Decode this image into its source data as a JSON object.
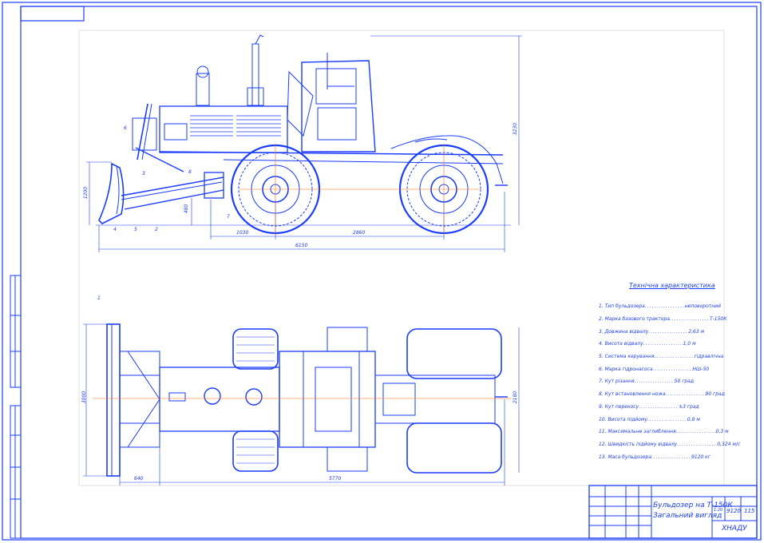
{
  "drawing": {
    "title_line1": "Бульдозер на Т-150К",
    "title_line2": "Загальний вигляд",
    "sheet_code": "ХНАДУ",
    "scale": "1:20",
    "mass": "9120",
    "sheet_no": "115"
  },
  "specs": {
    "heading": "Технічна характеристика",
    "items": [
      {
        "label": "1. Тип бульдозера",
        "value": "неповоротний"
      },
      {
        "label": "2. Марка базового трактора",
        "value": "Т-150К"
      },
      {
        "label": "3. Довжина відвалу",
        "value": "2,63 м"
      },
      {
        "label": "4. Висота відвалу",
        "value": "1,0 м"
      },
      {
        "label": "5. Система керування",
        "value": "гідравлічна"
      },
      {
        "label": "6. Марка гідронасоса",
        "value": "НШ-50"
      },
      {
        "label": "7. Кут різання",
        "value": "50 град"
      },
      {
        "label": "8. Кут встановлення ножа",
        "value": "90 град"
      },
      {
        "label": "9. Кут перекосу",
        "value": "±3 град"
      },
      {
        "label": "10. Висота підйому",
        "value": "0,8 м"
      },
      {
        "label": "11. Максимальне заглиблення",
        "value": "0,3 м"
      },
      {
        "label": "12. Швидкість підйому відвалу",
        "value": "0,324 м/с"
      },
      {
        "label": "13. Маса бульдозера",
        "value": "9120 кг"
      }
    ]
  },
  "dimensions": {
    "side": {
      "d1030": "1030",
      "d2860": "2860",
      "d6150": "6150",
      "d1200": "1200",
      "d480": "480",
      "d3230": "3230"
    },
    "top": {
      "d640": "640",
      "d5770": "5770",
      "d3000": "3000",
      "d2180": "2180"
    }
  },
  "callouts": [
    "1",
    "2",
    "3",
    "4",
    "5",
    "6",
    "7",
    "8"
  ],
  "colors": {
    "line": "#1a3cff",
    "axis": "#ff6a00",
    "frame": "#1a3cff"
  }
}
